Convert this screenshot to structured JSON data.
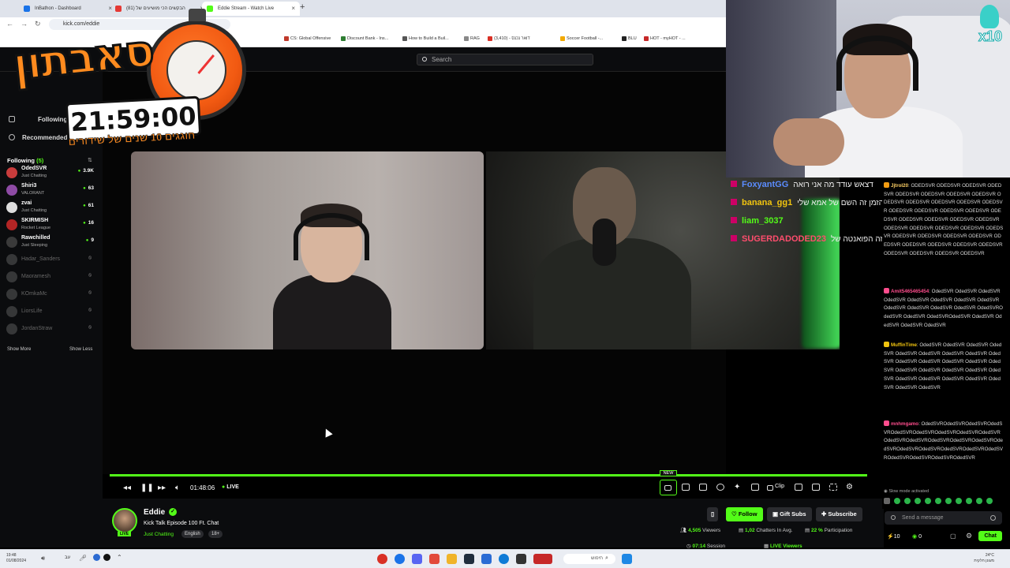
{
  "browser": {
    "tabs": [
      {
        "label": "InBathon - Dashboard",
        "color": "#1a73e8"
      },
      {
        "label": "הבקשים הכי מושיעים של (81)",
        "color": "#e53935"
      },
      {
        "label": "Eddie Stream - Watch Live",
        "color": "#53fc18"
      }
    ],
    "url": "kick.com/eddie",
    "bookmarks": [
      {
        "label": "CS: Global Offensive",
        "color": "#c0392b"
      },
      {
        "label": "Discount Bank - Ins...",
        "color": "#2e7d32"
      },
      {
        "label": "How to Build a Buil...",
        "color": "#555555"
      },
      {
        "label": "RAG",
        "color": "#888888"
      },
      {
        "label": "(3,410) - דואר נכנס",
        "color": "#d93025"
      },
      {
        "label": "Soccer Football -...",
        "color": "#f2a900"
      },
      {
        "label": "BLU",
        "color": "#222222"
      },
      {
        "label": "HOT - myHOT - ...",
        "color": "#c62828"
      }
    ]
  },
  "site": {
    "search_placeholder": "Search"
  },
  "sidebar": {
    "nav": {
      "following_label": "Following",
      "recommended_label": "Recommended"
    },
    "following_title": "Following",
    "following_count": "(5)",
    "following": [
      {
        "name": "OdedSVR",
        "category": "Just Chatting",
        "viewers": "3.9K",
        "avatar": "#c83c3c",
        "live": true
      },
      {
        "name": "Shiri3",
        "category": "VALORANT",
        "viewers": "63",
        "avatar": "#8e4ba5",
        "live": true
      },
      {
        "name": "zvai",
        "category": "Just Chatting",
        "viewers": "61",
        "avatar": "#dddddd",
        "live": true
      },
      {
        "name": "SKIRMISH",
        "category": "Rocket League",
        "viewers": "16",
        "avatar": "#b32525",
        "live": true
      },
      {
        "name": "Rawchilled",
        "category": "Just Sleeping",
        "viewers": "9",
        "avatar": "#3a3a3a",
        "live": true
      },
      {
        "name": "Hadar_Sanders",
        "category": "",
        "viewers": "",
        "avatar": "#777777",
        "live": false
      },
      {
        "name": "Maoramesh",
        "category": "",
        "viewers": "",
        "avatar": "#777777",
        "live": false
      },
      {
        "name": "KOmkaMc",
        "category": "",
        "viewers": "",
        "avatar": "#777777",
        "live": false
      },
      {
        "name": "LiorsLife",
        "category": "",
        "viewers": "",
        "avatar": "#777777",
        "live": false
      },
      {
        "name": "JordanStraw",
        "category": "",
        "viewers": "",
        "avatar": "#777777",
        "live": false
      }
    ],
    "show_more": "Show More",
    "show_less": "Show Less"
  },
  "overlay": {
    "title": "סאבתון",
    "timer": "21:59:00",
    "subtitle": "חוגגים 10 שנים של שידורים"
  },
  "player": {
    "time": "01:48:06",
    "live": "LIVE",
    "new_badge": "NEW",
    "clip_label": "Clip",
    "progress_fraction": 1.0
  },
  "stream": {
    "streamer": "Eddie",
    "title": "Kick Talk Episode 100 Ft. Chat",
    "category": "Just Chatting",
    "tags": [
      "English",
      "18+"
    ],
    "live_badge": "LIVE",
    "follow_label": "Follow",
    "gift_label": "Gift Subs",
    "subscribe_label": "Subscribe",
    "viewers": "4,505",
    "viewers_label": "Viewers",
    "chatters": "1,02",
    "chatters_label": "Chatters In Avg.",
    "participation": "22 %",
    "participation_label": "Participation",
    "session": "07:14",
    "session_label": "Session",
    "live_viewers_label": "LIVE Viewers"
  },
  "webcam": {
    "badge": "x10"
  },
  "chat_overlay": [
    {
      "user": "FoxyantGG",
      "text": "דצאש עודד מה אני רואה",
      "color": "#5b8cff"
    },
    {
      "user": "banana_gg1",
      "text": "די חשבתי זה הזמן זה השם של אמא שלי",
      "color": "#f1c40f"
    },
    {
      "user": "liam_3037",
      "text": "",
      "color": "#53fc18"
    },
    {
      "user": "SUGERDADODED23",
      "text": "זה הפואנטה של",
      "color": "#ff4d6d"
    }
  ],
  "chat": {
    "messages": [
      {
        "user": "Jjtrol20",
        "color": "#ffd166",
        "badge": "#f39c12",
        "text": "ODEDSVR ODEDSVR ODEDSVR ODEDSVR ODEDSVR ODEDSVR ODEDSVR ODEDSVR ODEDSVR ODEDSVR ODEDSVR ODEDSVR ODEDSVR ODEDSVR ODEDSVR ODEDSVR ODEDSVR ODEDSVR ODEDSVR ODEDSVR ODEDSVR ODEDSVR ODEDSVR ODEDSVR ODEDSVR ODEDSVR ODEDSVR ODEDSVR ODEDSVR ODEDSVR ODEDSVR ODEDSVR ODEDSVR ODEDSVR ODEDSVR ODEDSVR ODEDSVR ODEDSVR ODEDSVR ODEDSVR"
      },
      {
        "user": "Amit5465465454",
        "color": "#ff4d8d",
        "badge": "#ff4d8d",
        "text": "OdedSVR OdedSVR OdedSVR OdedSVR OdedSVR OdedSVR OdedSVR OdedSVR OdedSVR OdedSVR OdedSVR OdedSVR OdedSVROdedSVR OdedSVR OdedSVROdedSVR OdedSVR OdedSVR OdedSVR OdedSVR"
      },
      {
        "user": "MuffinTime",
        "color": "#f1c40f",
        "badge": "#f1c40f",
        "text": "OdedSVR OdedSVR OdedSVR OdedSVR OdedSVR OdedSVR OdedSVR OdedSVR OdedSVR OdedSVR OdedSVR OdedSVR OdedSVR OdedSVR OdedSVR OdedSVR OdedSVR OdedSVR OdedSVR OdedSVR OdedSVR OdedSVR OdedSVR OdedSVR OdedSVR OdedSVR"
      },
      {
        "user": "mnhmgamo",
        "color": "#ff4d8d",
        "badge": "#ff4d8d",
        "text": "OdedSVROdedSVROdedSVROdedSVROdedSVROdedSVROdedSVROdedSVROdedSVROdedSVROdedSVROdedSVROdedSVROdedSVROdedSVROdedSVROdedSVROdedSVROdedSVROdedSVROdedSVROdedSVROdedSVROdedSVR"
      }
    ],
    "slow_mode": "Slow mode activated",
    "input_placeholder": "Send a message",
    "points": "10",
    "score": "0",
    "chat_button": "Chat"
  },
  "taskbar": {
    "time": "19:48",
    "date": "01/08/2024",
    "search_text": "חיפוש",
    "temp": "24°C",
    "weather": "מעונן חלקית"
  }
}
